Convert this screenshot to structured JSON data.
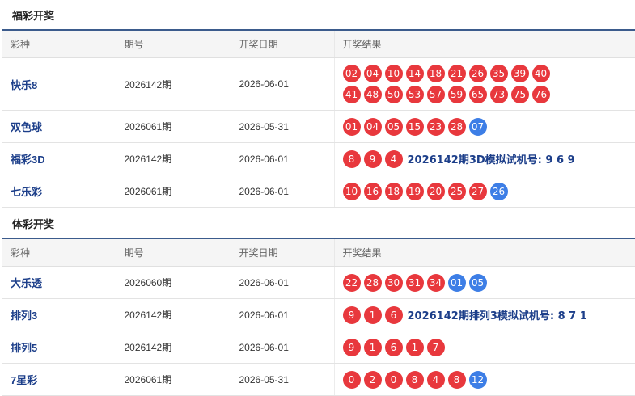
{
  "fucai": {
    "title": "福彩开奖",
    "headers": [
      "彩种",
      "期号",
      "开奖日期",
      "开奖结果"
    ],
    "rows": [
      {
        "name": "快乐8",
        "issue": "2026142期",
        "date": "2026-06-01",
        "lines": [
          [
            {
              "n": "02",
              "c": "red"
            },
            {
              "n": "04",
              "c": "red"
            },
            {
              "n": "10",
              "c": "red"
            },
            {
              "n": "14",
              "c": "red"
            },
            {
              "n": "18",
              "c": "red"
            },
            {
              "n": "21",
              "c": "red"
            },
            {
              "n": "26",
              "c": "red"
            },
            {
              "n": "35",
              "c": "red"
            },
            {
              "n": "39",
              "c": "red"
            },
            {
              "n": "40",
              "c": "red"
            }
          ],
          [
            {
              "n": "41",
              "c": "red"
            },
            {
              "n": "48",
              "c": "red"
            },
            {
              "n": "50",
              "c": "red"
            },
            {
              "n": "53",
              "c": "red"
            },
            {
              "n": "57",
              "c": "red"
            },
            {
              "n": "59",
              "c": "red"
            },
            {
              "n": "65",
              "c": "red"
            },
            {
              "n": "73",
              "c": "red"
            },
            {
              "n": "75",
              "c": "red"
            },
            {
              "n": "76",
              "c": "red"
            }
          ]
        ],
        "trial": ""
      },
      {
        "name": "双色球",
        "issue": "2026061期",
        "date": "2026-05-31",
        "lines": [
          [
            {
              "n": "01",
              "c": "red"
            },
            {
              "n": "04",
              "c": "red"
            },
            {
              "n": "05",
              "c": "red"
            },
            {
              "n": "15",
              "c": "red"
            },
            {
              "n": "23",
              "c": "red"
            },
            {
              "n": "28",
              "c": "red"
            },
            {
              "n": "07",
              "c": "blue"
            }
          ]
        ],
        "trial": ""
      },
      {
        "name": "福彩3D",
        "issue": "2026142期",
        "date": "2026-06-01",
        "lines": [
          [
            {
              "n": "8",
              "c": "red"
            },
            {
              "n": "9",
              "c": "red"
            },
            {
              "n": "4",
              "c": "red"
            }
          ]
        ],
        "trial": "2026142期3D模拟试机号: 9 6 9"
      },
      {
        "name": "七乐彩",
        "issue": "2026061期",
        "date": "2026-06-01",
        "lines": [
          [
            {
              "n": "10",
              "c": "red"
            },
            {
              "n": "16",
              "c": "red"
            },
            {
              "n": "18",
              "c": "red"
            },
            {
              "n": "19",
              "c": "red"
            },
            {
              "n": "20",
              "c": "red"
            },
            {
              "n": "25",
              "c": "red"
            },
            {
              "n": "27",
              "c": "red"
            },
            {
              "n": "26",
              "c": "blue"
            }
          ]
        ],
        "trial": ""
      }
    ]
  },
  "ticai": {
    "title": "体彩开奖",
    "headers": [
      "彩种",
      "期号",
      "开奖日期",
      "开奖结果"
    ],
    "rows": [
      {
        "name": "大乐透",
        "issue": "2026060期",
        "date": "2026-06-01",
        "lines": [
          [
            {
              "n": "22",
              "c": "red"
            },
            {
              "n": "28",
              "c": "red"
            },
            {
              "n": "30",
              "c": "red"
            },
            {
              "n": "31",
              "c": "red"
            },
            {
              "n": "34",
              "c": "red"
            },
            {
              "n": "01",
              "c": "blue"
            },
            {
              "n": "05",
              "c": "blue"
            }
          ]
        ],
        "trial": ""
      },
      {
        "name": "排列3",
        "issue": "2026142期",
        "date": "2026-06-01",
        "lines": [
          [
            {
              "n": "9",
              "c": "red"
            },
            {
              "n": "1",
              "c": "red"
            },
            {
              "n": "6",
              "c": "red"
            }
          ]
        ],
        "trial": "2026142期排列3模拟试机号: 8 7 1"
      },
      {
        "name": "排列5",
        "issue": "2026142期",
        "date": "2026-06-01",
        "lines": [
          [
            {
              "n": "9",
              "c": "red"
            },
            {
              "n": "1",
              "c": "red"
            },
            {
              "n": "6",
              "c": "red"
            },
            {
              "n": "1",
              "c": "red"
            },
            {
              "n": "7",
              "c": "red"
            }
          ]
        ],
        "trial": ""
      },
      {
        "name": "7星彩",
        "issue": "2026061期",
        "date": "2026-05-31",
        "lines": [
          [
            {
              "n": "0",
              "c": "red"
            },
            {
              "n": "2",
              "c": "red"
            },
            {
              "n": "0",
              "c": "red"
            },
            {
              "n": "8",
              "c": "red"
            },
            {
              "n": "4",
              "c": "red"
            },
            {
              "n": "8",
              "c": "red"
            },
            {
              "n": "12",
              "c": "blue"
            }
          ]
        ],
        "trial": ""
      }
    ]
  }
}
